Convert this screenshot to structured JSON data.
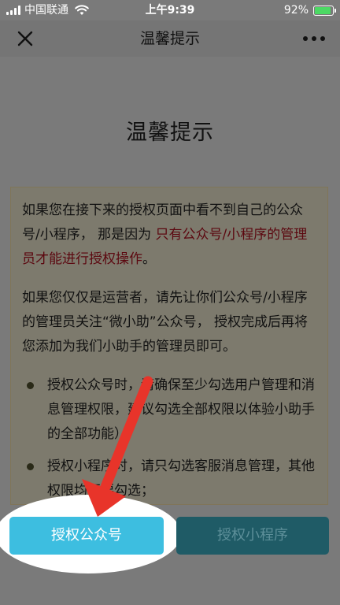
{
  "status_bar": {
    "carrier": "中国联通",
    "time": "上午9:39",
    "battery": "92%",
    "battery_level": 0.92
  },
  "nav": {
    "title": "温馨提示",
    "close_icon": "close-icon",
    "more_icon": "more-icon"
  },
  "content": {
    "heading": "温馨提示",
    "para1_part1": "如果您在接下来的授权页面中看不到自己的公众号/小程序， 那是因为 ",
    "para1_highlight": "只有公众号/小程序的管理员才能进行授权操作",
    "para1_part2": "。",
    "para2": "如果您仅仅是运营者，请先让你们公众号/小程序的管理员关注“微小助”公众号， 授权完成后再将您添加为我们小助手的管理员即可。",
    "bullets": [
      "授权公众号时，请确保至少勾选用户管理和消息管理权限，建议勾选全部权限以体验小助手的全部功能）；",
      "授权小程序时，请只勾选客服消息管理，其他权限均不要勾选；"
    ]
  },
  "buttons": {
    "authorize_official_account": "授权公众号",
    "authorize_mini_program": "授权小程序"
  },
  "colors": {
    "primary_button": "#3dbee0",
    "highlight_text": "#5c0810",
    "arrow": "#e8342a"
  }
}
